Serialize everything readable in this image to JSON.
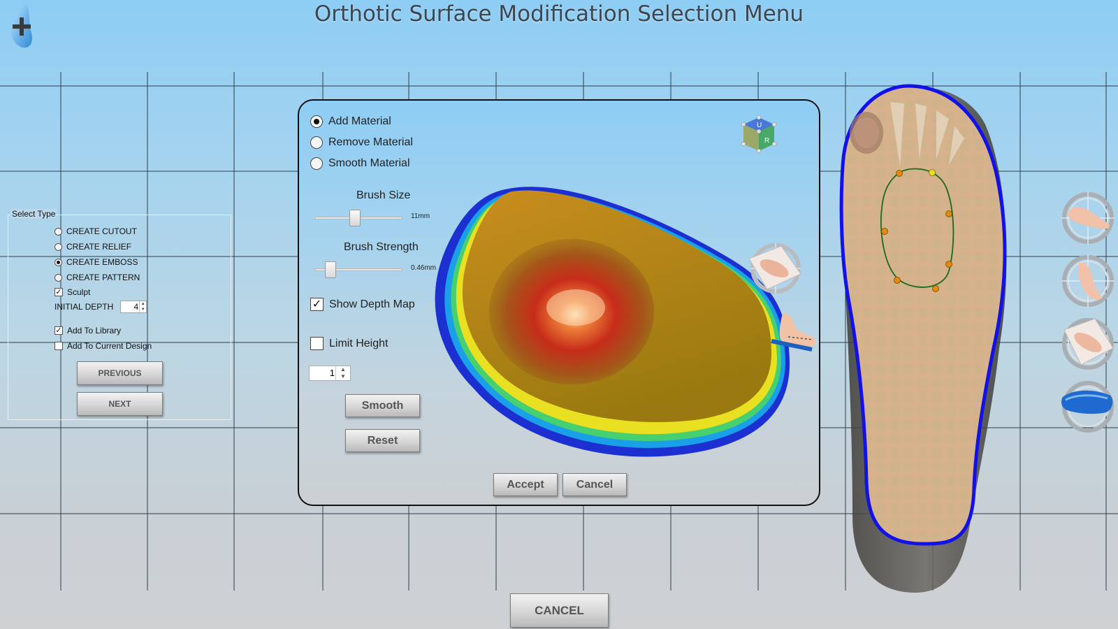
{
  "app": {
    "title": "Orthotic Surface Modification Selection Menu"
  },
  "select_type": {
    "legend": "Select Type",
    "options": [
      {
        "label": "CREATE CUTOUT",
        "selected": false
      },
      {
        "label": "CREATE RELIEF",
        "selected": false
      },
      {
        "label": "CREATE EMBOSS",
        "selected": true
      },
      {
        "label": "CREATE PATTERN",
        "selected": false
      }
    ],
    "sculpt": {
      "label": "Sculpt",
      "checked": true
    },
    "initial_depth": {
      "label": "INITIAL DEPTH",
      "value": "4"
    },
    "add_to_library": {
      "label": "Add To Library",
      "checked": true
    },
    "add_to_current_design": {
      "label": "Add To Current Design",
      "checked": false
    },
    "previous_label": "PREVIOUS",
    "next_label": "NEXT"
  },
  "dialog": {
    "material_options": [
      {
        "label": "Add Material",
        "selected": true
      },
      {
        "label": "Remove Material",
        "selected": false
      },
      {
        "label": "Smooth Material",
        "selected": false
      }
    ],
    "brush_size": {
      "label": "Brush Size",
      "value_text": "11mm",
      "fraction": 0.45
    },
    "brush_strength": {
      "label": "Brush Strength",
      "value_text": "0.46mm",
      "fraction": 0.18
    },
    "show_depth_map": {
      "label": "Show Depth Map",
      "checked": true
    },
    "limit_height": {
      "label": "Limit Height",
      "checked": false,
      "value": "1"
    },
    "smooth_label": "Smooth",
    "reset_label": "Reset",
    "accept_label": "Accept",
    "cancel_label": "Cancel",
    "view_cube": {
      "top": "U",
      "right": "R"
    }
  },
  "cancel_label": "CANCEL",
  "icons": {
    "logo": "foot-plus-logo-icon",
    "side_tools": [
      "foot-side-view-icon",
      "foot-medial-view-icon",
      "foot-top-grid-view-icon",
      "insole-rotate-view-icon"
    ]
  }
}
